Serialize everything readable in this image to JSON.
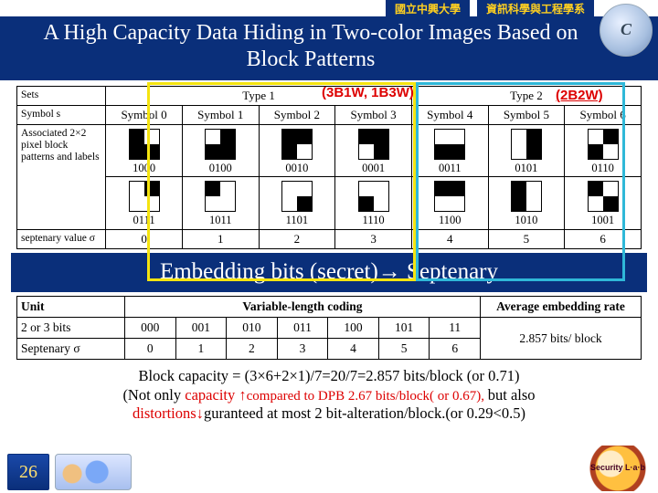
{
  "top": {
    "univ": "國立中興大學",
    "dept": "資訊科學與工程學系"
  },
  "title": "A High Capacity Data Hiding in Two-color Images Based on Block Patterns",
  "logo_letter": "C",
  "annot": {
    "type1": "(3B1W, 1B3W)",
    "type2": "(2B2W)"
  },
  "patterns": {
    "row_sets": "Sets",
    "type1_label": "Type 1",
    "type2_label": "Type 2",
    "row_symbol": "Symbol s",
    "symbol_labels": [
      "Symbol 0",
      "Symbol 1",
      "Symbol 2",
      "Symbol 3",
      "Symbol 4",
      "Symbol 5",
      "Symbol 6"
    ],
    "row_assoc": "Associated 2×2 pixel block patterns and labels",
    "top_patterns": [
      {
        "p": "bwbb",
        "l": "1000"
      },
      {
        "p": "wbbb",
        "l": "0100"
      },
      {
        "p": "bbbw",
        "l": "0010"
      },
      {
        "p": "bbwb",
        "l": "0001"
      },
      {
        "p": "wwbb",
        "l": "0011"
      },
      {
        "p": "wbwb",
        "l": "0101"
      },
      {
        "p": "wbbw",
        "l": "0110"
      }
    ],
    "bot_patterns": [
      {
        "p": "wbww",
        "l": "0111"
      },
      {
        "p": "bwww",
        "l": "1011"
      },
      {
        "p": "wwwb",
        "l": "1101"
      },
      {
        "p": "wwbw",
        "l": "1110"
      },
      {
        "p": "bbww",
        "l": "1100"
      },
      {
        "p": "bwbw",
        "l": "1010"
      },
      {
        "p": "bwwb",
        "l": "1001"
      }
    ],
    "row_sept": "septenary value σ",
    "sept_vals": [
      "0",
      "1",
      "2",
      "3",
      "4",
      "5",
      "6"
    ]
  },
  "banner2_a": "Embedding bits (secret)",
  "banner2_arrow": "→",
  "banner2_b": " Septenary",
  "vlc": {
    "h_unit": "Unit",
    "h_vlc": "Variable-length coding",
    "h_rate": "Average embedding rate",
    "unit_val": "2 or 3 bits",
    "codes": [
      "000",
      "001",
      "010",
      "011",
      "100",
      "101",
      "11"
    ],
    "rate_val": "2.857 bits/ block",
    "sept_label": "Septenary   σ",
    "sept_vals": [
      "0",
      "1",
      "2",
      "3",
      "4",
      "5",
      "6"
    ]
  },
  "explain": {
    "l1a": "Block capacity = (3×6+2×1)/7=20/7=2.857 bits/block (or 0.71)",
    "l2a": "(Not only ",
    "l2b": "capacity ↑",
    "l2c": "compared to DPB 2.67 bits/block( or 0.67), ",
    "l2d": "but also",
    "l3a": "distortions↓",
    "l3b": "guranteed at most 2 bit-alteration/block.(or 0.29<0.5)"
  },
  "page_no": "26",
  "sec_logo": "Security L·a·b"
}
